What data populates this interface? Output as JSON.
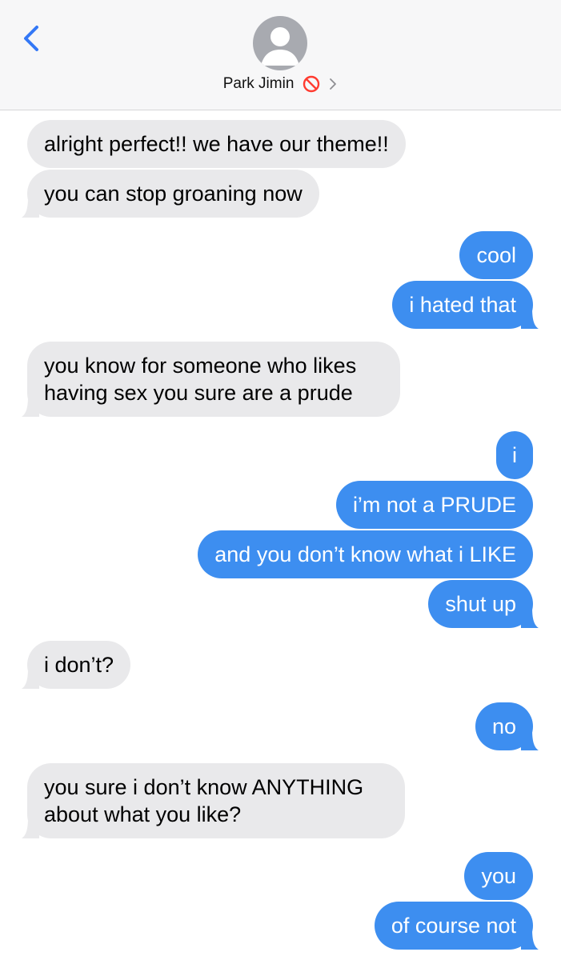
{
  "header": {
    "contact_name": "Park Jimin"
  },
  "colors": {
    "incoming_bubble": "#e9e9eb",
    "outgoing_bubble": "#3d8ef0",
    "accent": "#3478f6",
    "blocked": "#ff3b30"
  },
  "messages": [
    {
      "from": "them",
      "text": "alright perfect!! we have our theme!!"
    },
    {
      "from": "them",
      "text": "you can stop groaning now"
    },
    {
      "from": "me",
      "text": "cool"
    },
    {
      "from": "me",
      "text": "i hated that"
    },
    {
      "from": "them",
      "text": "you know for someone who likes having sex you sure are a prude"
    },
    {
      "from": "me",
      "text": "i"
    },
    {
      "from": "me",
      "text": "i’m not a PRUDE"
    },
    {
      "from": "me",
      "text": "and you don’t know what i LIKE"
    },
    {
      "from": "me",
      "text": "shut up"
    },
    {
      "from": "them",
      "text": "i don’t?"
    },
    {
      "from": "me",
      "text": "no"
    },
    {
      "from": "them",
      "text": "you sure i don’t know ANYTHING about what you like?"
    },
    {
      "from": "me",
      "text": "you"
    },
    {
      "from": "me",
      "text": "of course not"
    }
  ]
}
